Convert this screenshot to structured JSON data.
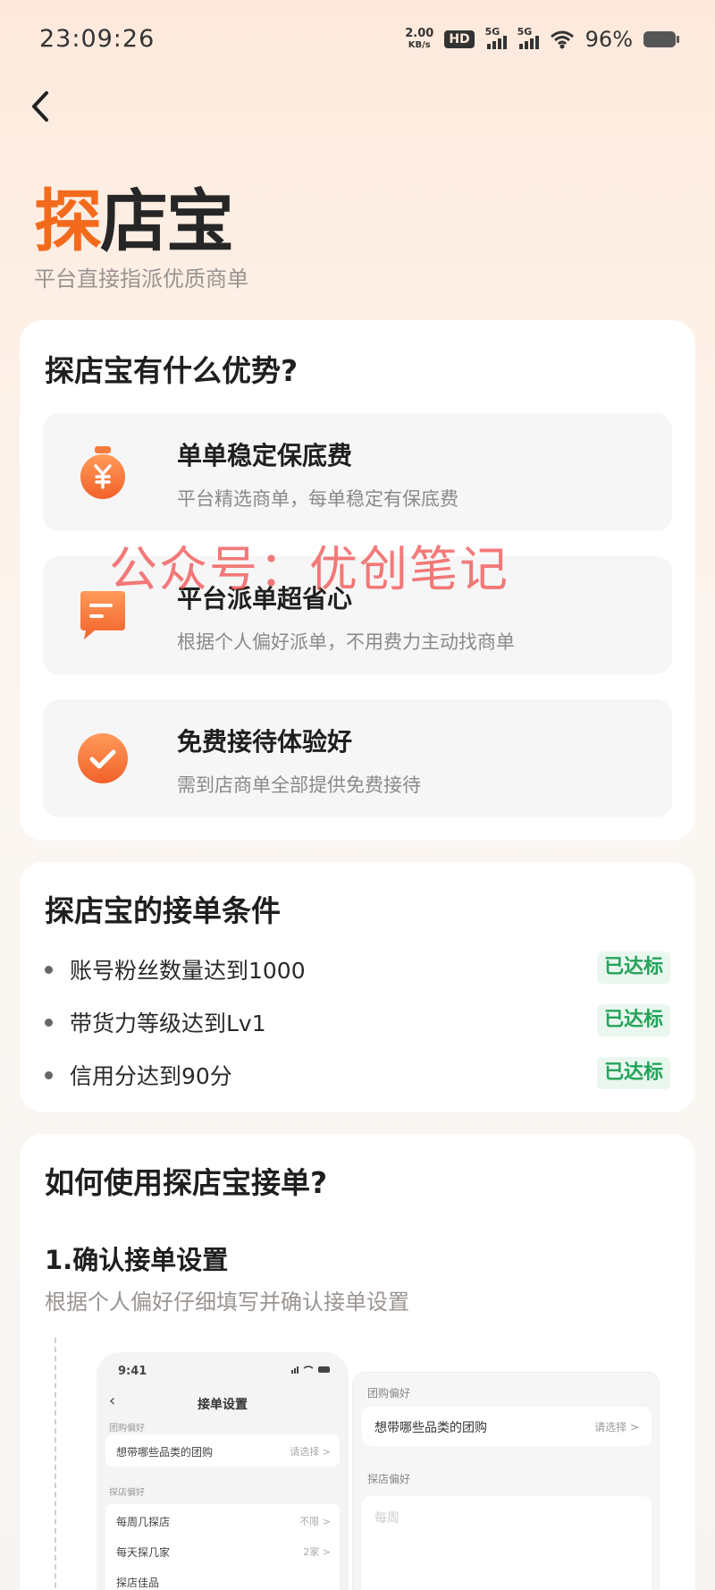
{
  "status_bar": {
    "time": "23:09:26",
    "net_speed_value": "2.00",
    "net_speed_unit": "KB/s",
    "hd_label": "HD",
    "sim1_label": "5G",
    "sim2_label": "5G",
    "battery_percent": "96%"
  },
  "header": {
    "logo_part1": "探",
    "logo_part2": "店宝",
    "slogan": "平台直接指派优质商单"
  },
  "advantages": {
    "title": "探店宝有什么优势?",
    "items": [
      {
        "title": "单单稳定保底费",
        "desc": "平台精选商单，每单稳定有保底费",
        "icon": "money-bag-icon"
      },
      {
        "title": "平台派单超省心",
        "desc": "根据个人偏好派单，不用费力主动找商单",
        "icon": "message-icon"
      },
      {
        "title": "免费接待体验好",
        "desc": "需到店商单全部提供免费接待",
        "icon": "check-circle-icon"
      }
    ]
  },
  "watermark": "公众号：优创笔记",
  "conditions": {
    "title": "探店宝的接单条件",
    "items": [
      {
        "text": "账号粉丝数量达到1000",
        "status": "已达标"
      },
      {
        "text": "带货力等级达到Lv1",
        "status": "已达标"
      },
      {
        "text": "信用分达到90分",
        "status": "已达标"
      }
    ]
  },
  "how_to": {
    "title": "如何使用探店宝接单?",
    "step1_title": "1.确认接单设置",
    "step1_desc": "根据个人偏好仔细填写并确认接单设置",
    "phone": {
      "time": "9:41",
      "title": "接单设置",
      "section1": "团购偏好",
      "row1_label": "想带哪些品类的团购",
      "row1_value": "请选择 >",
      "section2": "探店偏好",
      "row2_label": "每周几探店",
      "row2_value": "不限 >",
      "row3_label": "每天探几家",
      "row3_value": "2家 >",
      "row4_label": "探店佳品"
    },
    "panel": {
      "section1": "团购偏好",
      "row1_label": "想带哪些品类的团购",
      "row1_value": "请选择 >",
      "section2": "探店偏好",
      "faded_text": "每周"
    }
  },
  "colors": {
    "accent": "#f46a1c",
    "success": "#24a35a",
    "watermark": "#f04646"
  }
}
